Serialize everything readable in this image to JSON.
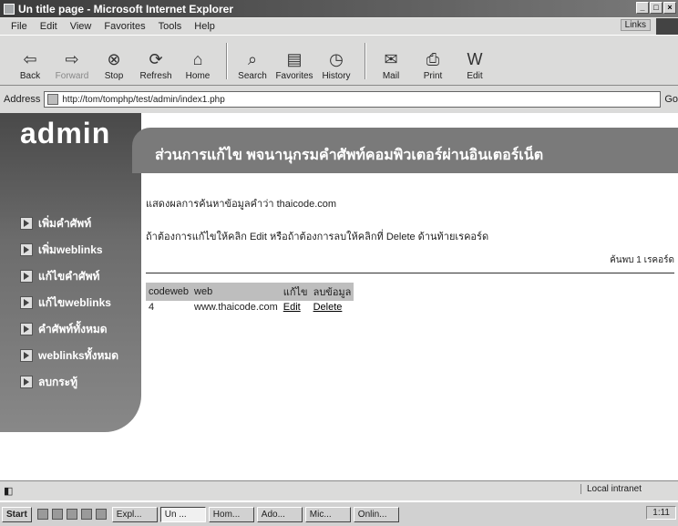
{
  "window": {
    "title": "Un title page - Microsoft Internet Explorer"
  },
  "menu": {
    "items": [
      "File",
      "Edit",
      "View",
      "Favorites",
      "Tools",
      "Help"
    ],
    "links": "Links"
  },
  "toolbar": {
    "back": "Back",
    "forward": "Forward",
    "stop": "Stop",
    "refresh": "Refresh",
    "home": "Home",
    "search": "Search",
    "favorites": "Favorites",
    "history": "History",
    "mail": "Mail",
    "print": "Print",
    "edit": "Edit"
  },
  "address": {
    "label": "Address",
    "url": "http://tom/tomphp/test/admin/index1.php",
    "go": "Go"
  },
  "page": {
    "logo": "admin",
    "header_title": "ส่วนการแก้ไข พจนานุกรมคำศัพท์คอมพิวเตอร์ผ่านอินเตอร์เน็ต",
    "nav": [
      "เพิ่มคำศัพท์",
      "เพิ่มweblinks",
      "แก้ไขคำศัพท์",
      "แก้ไขweblinks",
      "คำศัพท์ทั้งหมด",
      "weblinksทั้งหมด",
      "ลบกระทู้"
    ],
    "search_result": "แสดงผลการค้นหาข้อมูลคำว่า thaicode.com",
    "instruction": "ถ้าต้องการแก้ไขให้คลิก Edit หรือถ้าต้องการลบให้คลิกที่ Delete ด้านท้ายเรคอร์ด",
    "found_count": "ค้นพบ 1 เรคอร์ด",
    "table": {
      "headers": [
        "codeweb",
        "web",
        "แก้ไข",
        "ลบข้อมูล"
      ],
      "rows": [
        {
          "codeweb": "4",
          "web": "www.thaicode.com",
          "edit": "Edit",
          "delete": "Delete"
        }
      ]
    }
  },
  "status": {
    "zone": "Local intranet"
  },
  "taskbar": {
    "start": "Start",
    "tasks": [
      "Expl...",
      "Un ...",
      "Hom...",
      "Ado...",
      "Mic...",
      "Onlin..."
    ],
    "clock": "1:11"
  }
}
